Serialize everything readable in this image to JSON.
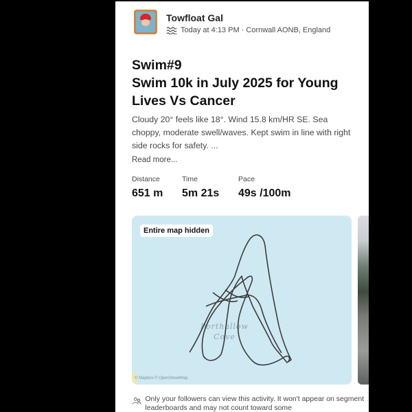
{
  "post": {
    "athlete_name": "Towfloat Gal",
    "meta_text": "Today at 4:13 PM · Cornwall AONB, England",
    "title_line1": "Swim#9",
    "title_line2": "Swim 10k in July 2025 for Young",
    "title_line3": "Lives Vs Cancer",
    "description": "Cloudy 20° feels like 18°.  Wind 15.8 km/HR SE.  Sea choppy, moderate swell/waves. Kept swim in line with right side rocks for safety. ...",
    "read_more": "Read more...",
    "icons": {
      "activity_type": "water-waves-icon",
      "privacy": "followers-icon"
    }
  },
  "stats": [
    {
      "label": "Distance",
      "value": "651 m"
    },
    {
      "label": "Time",
      "value": "5m 21s"
    },
    {
      "label": "Pace",
      "value": "49s /100m"
    }
  ],
  "map": {
    "badge": "Entire map hidden",
    "place_line1": "Porthallow",
    "place_line2": "Cove",
    "attribution": "© Mapbox © OpenStreetMap",
    "water_color": "#cfe9f2",
    "route_color": "#3b3b3b"
  },
  "privacy_notice": "Only your followers can view this activity. It won't appear on segment leaderboards and may not count toward some"
}
